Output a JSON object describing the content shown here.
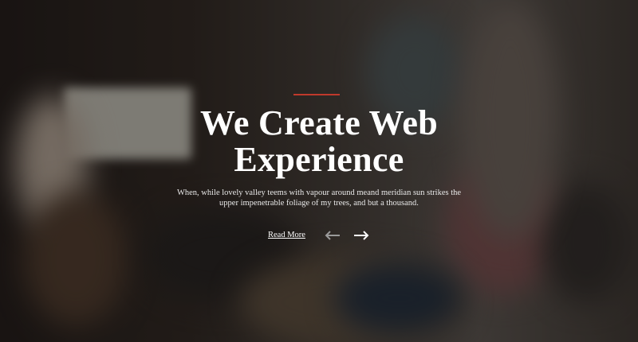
{
  "hero": {
    "title_line1": "We Create Web",
    "title_line2": "Experience",
    "description": "When, while lovely valley teems with vapour around meand meridian sun strikes the upper impenetrable foliage of my trees, and but a thousand.",
    "read_more_label": "Read More",
    "accent_color": "#c0392b",
    "prev_icon": "arrow-left-icon",
    "next_icon": "arrow-right-icon"
  }
}
